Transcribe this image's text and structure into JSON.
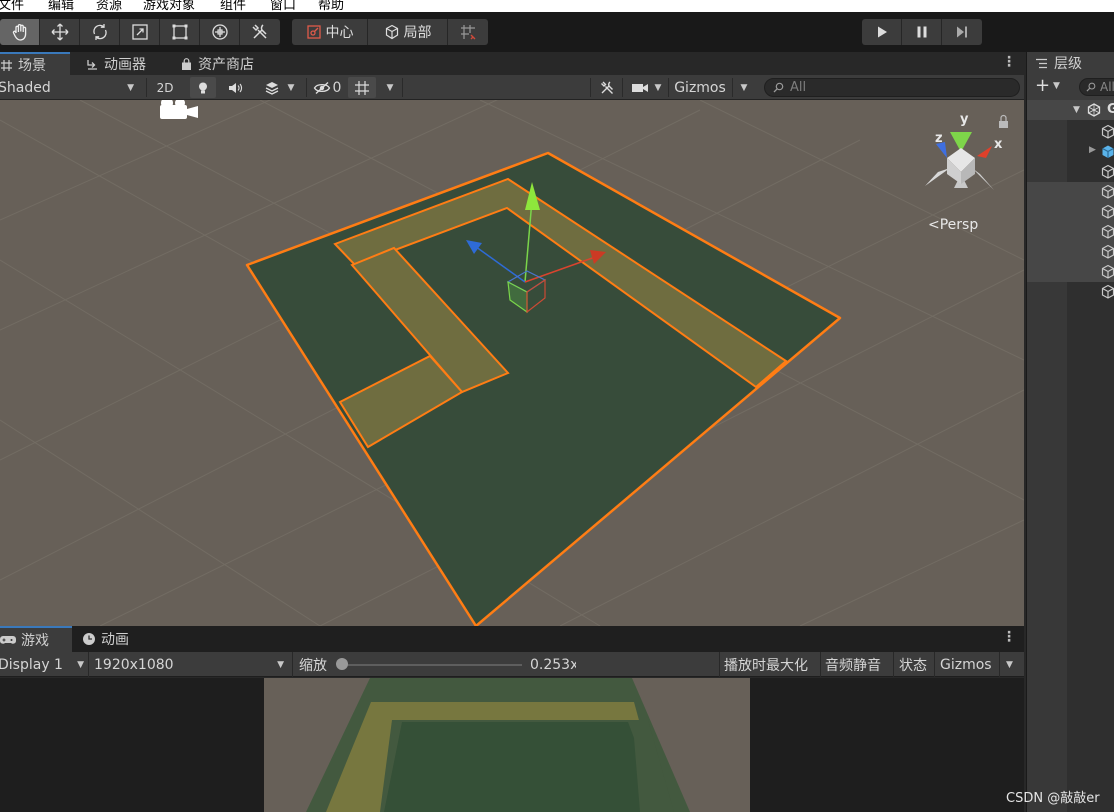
{
  "menu": {
    "items": [
      "文件",
      "编辑",
      "资源",
      "游戏对象",
      "组件",
      "窗口",
      "帮助"
    ]
  },
  "toolbar": {
    "tools": [
      "hand-icon",
      "move-icon",
      "rotate-icon",
      "scale-icon",
      "rect-icon",
      "transform-icon",
      "custom-tool-icon"
    ],
    "pivot_label": "中心",
    "space_label": "局部",
    "play": [
      "play-icon",
      "pause-icon",
      "step-icon"
    ]
  },
  "scene_tabs": [
    {
      "label": "场景",
      "icon": "grid-icon"
    },
    {
      "label": "动画器",
      "icon": "animator-icon"
    },
    {
      "label": "资产商店",
      "icon": "shop-icon"
    }
  ],
  "scene_toolbar": {
    "draw_mode": "Shaded",
    "two_d": "2D",
    "hidden_count": "0",
    "gizmos": "Gizmos",
    "search_placeholder": "All"
  },
  "scene": {
    "projection": "<Persp",
    "axis_x": "x",
    "axis_y": "y",
    "axis_z": "z"
  },
  "game_tabs": [
    {
      "label": "游戏",
      "icon": "gamepad-icon"
    },
    {
      "label": "动画",
      "icon": "clock-icon"
    }
  ],
  "game_toolbar": {
    "display": "Display 1",
    "resolution": "1920x1080",
    "scale_label": "缩放",
    "scale_value": "0.253x",
    "maximize": "播放时最大化",
    "mute": "音频静音",
    "stats": "状态",
    "gizmos": "Gizmos"
  },
  "hierarchy": {
    "title": "层级",
    "search_placeholder": "All"
  },
  "watermark": "CSDN @敲敲er",
  "colors": {
    "selection": "#ff7d14",
    "ground": "#374c3a",
    "path": "#6f6d40",
    "sky": "#676058"
  }
}
